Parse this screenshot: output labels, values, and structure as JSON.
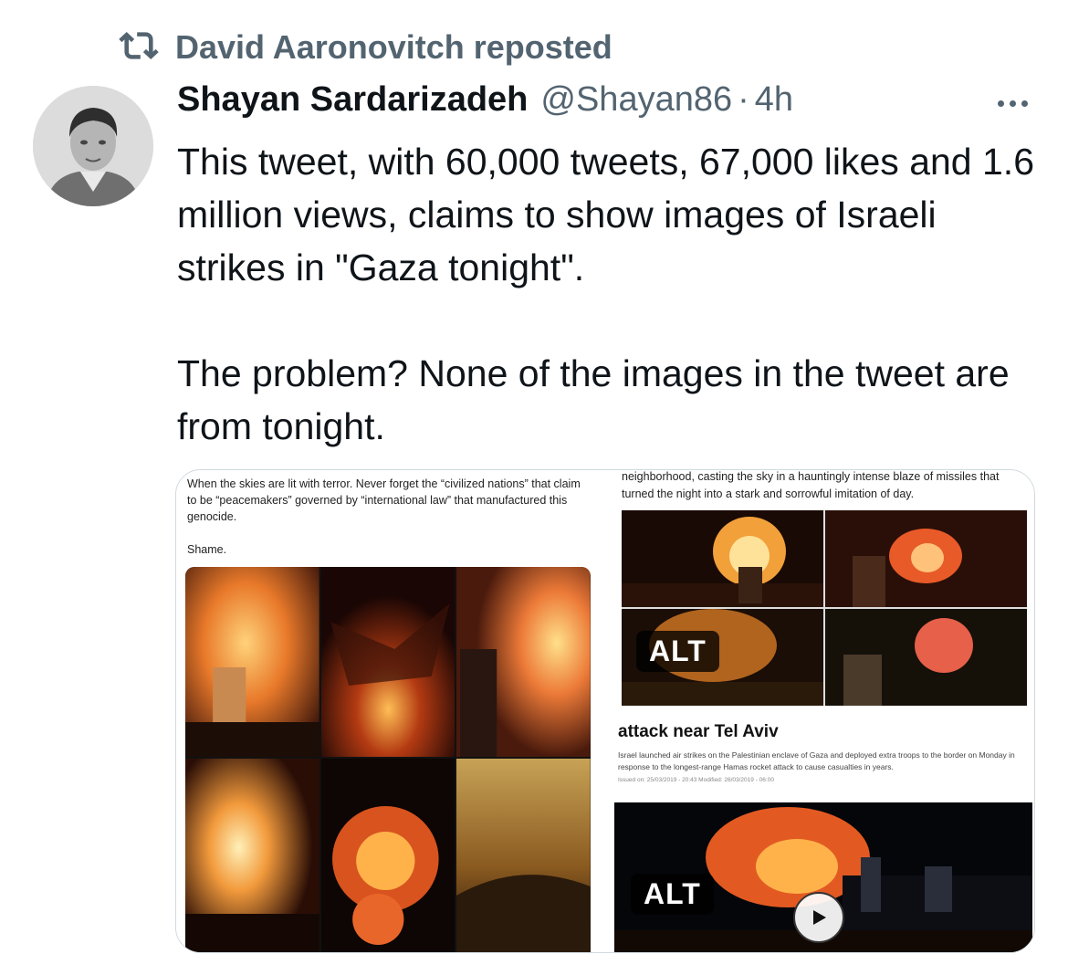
{
  "repost": {
    "icon": "repost-icon",
    "text": "David Aaronovitch reposted"
  },
  "author": {
    "name": "Shayan Sardarizadeh",
    "handle": "@Shayan86",
    "separator": "·",
    "time": "4h"
  },
  "tweet": {
    "paragraph_1": "This tweet, with 60,000 tweets, 67,000 likes and 1.6 million views, claims to show images of Israeli strikes in \"Gaza tonight\".",
    "paragraph_2": "The problem? None of the images in the tweet are from tonight."
  },
  "media": {
    "left_screenshot": {
      "caption": "When the skies are lit with terror. Never forget the “civilized nations” that claim to be “peacemakers” governed by “international law” that manufactured this genocide.",
      "shame": "Shame."
    },
    "right_top_screenshot": {
      "caption": "neighborhood, casting the sky in a hauntingly intense blaze of missiles that turned the night into a stark and sorrowful imitation of day.",
      "alt_label": "ALT"
    },
    "right_bottom_screenshot": {
      "headline": "attack near Tel Aviv",
      "body": "Israel launched air strikes on the Palestinian enclave of Gaza and deployed extra troops to the border on Monday in response to the longest-range Hamas rocket attack to cause casualties in years.",
      "issued": "Issued on: 25/03/2019 - 20:43   Modified: 26/03/2019 - 06:00",
      "alt_label": "ALT"
    }
  },
  "colors": {
    "text_primary": "#0f1419",
    "text_secondary": "#536471",
    "border": "#cfd9de"
  }
}
